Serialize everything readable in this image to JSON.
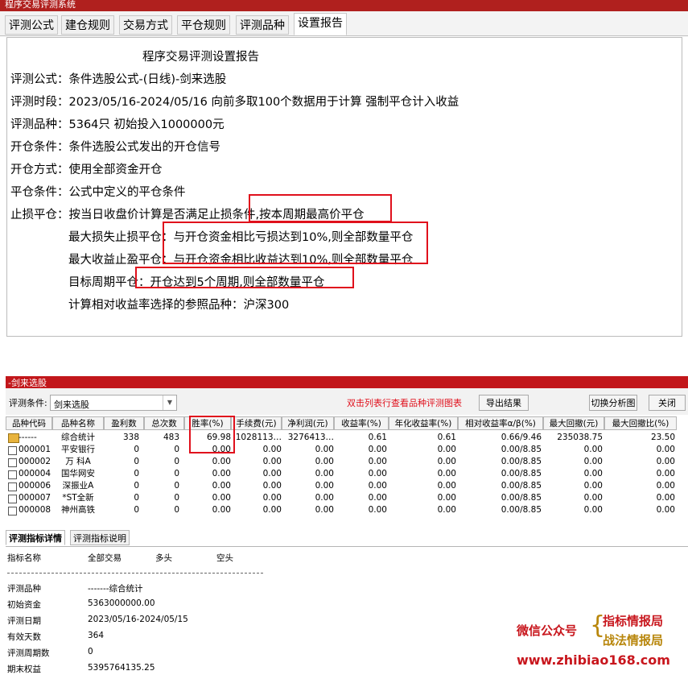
{
  "top_window": {
    "title": "程序交易评测系统",
    "tabs": [
      "评测公式",
      "建仓规则",
      "交易方式",
      "平仓规则",
      "评测品种",
      "设置报告"
    ],
    "active_tab": "设置报告",
    "report": {
      "heading": "程序交易评测设置报告",
      "formula": "评测公式：条件选股公式-(日线)-剑来选股",
      "period": "评测时段：2023/05/16-2024/05/16 向前多取100个数据用于计算 强制平仓计入收益",
      "symbols": "评测品种：5364只 初始投入1000000元",
      "open_cond": "开仓条件：条件选股公式发出的开仓信号",
      "open_mode": "开仓方式：使用全部资金开仓",
      "close_cond": "平仓条件：公式中定义的平仓条件",
      "stoploss": "止损平仓：按当日收盘价计算是否满足止损条件,按本周期最高价平仓",
      "max_loss": "最大损失止损平仓：与开仓资金相比亏损达到10%,则全部数量平仓",
      "max_gain": "最大收益止盈平仓：与开仓资金相比收益达到10%,则全部数量平仓",
      "target_period": "目标周期平仓：开仓达到5个周期,则全部数量平仓",
      "reference": "计算相对收益率选择的参照品种：沪深300"
    }
  },
  "bottom_window": {
    "title": "-剑来选股",
    "condition_label": "评测条件:",
    "condition_value": "剑来选股",
    "hint": "双击列表行查看品种评测图表",
    "export_button": "导出结果",
    "switch_button": "切换分析图",
    "close_button": "关闭",
    "columns": [
      "品种代码",
      "品种名称",
      "盈利数",
      "总次数",
      "胜率(%)",
      "手续费(元)",
      "净利润(元)",
      "收益率(%)",
      "年化收益率(%)",
      "相对收益率α/β(%)",
      "最大回撤(元)",
      "最大回撤比(%)"
    ],
    "rows": [
      [
        "------",
        "综合统计",
        "338",
        "483",
        "69.98",
        "1028113…",
        "3276413…",
        "0.61",
        "0.61",
        "0.66/9.46",
        "235038.75",
        "23.50"
      ],
      [
        "000001",
        "平安银行",
        "0",
        "0",
        "0.00",
        "0.00",
        "0.00",
        "0.00",
        "0.00",
        "0.00/8.85",
        "0.00",
        "0.00"
      ],
      [
        "000002",
        "万 科A",
        "0",
        "0",
        "0.00",
        "0.00",
        "0.00",
        "0.00",
        "0.00",
        "0.00/8.85",
        "0.00",
        "0.00"
      ],
      [
        "000004",
        "国华网安",
        "0",
        "0",
        "0.00",
        "0.00",
        "0.00",
        "0.00",
        "0.00",
        "0.00/8.85",
        "0.00",
        "0.00"
      ],
      [
        "000006",
        "深振业A",
        "0",
        "0",
        "0.00",
        "0.00",
        "0.00",
        "0.00",
        "0.00",
        "0.00/8.85",
        "0.00",
        "0.00"
      ],
      [
        "000007",
        "*ST全新",
        "0",
        "0",
        "0.00",
        "0.00",
        "0.00",
        "0.00",
        "0.00",
        "0.00/8.85",
        "0.00",
        "0.00"
      ],
      [
        "000008",
        "神州高铁",
        "0",
        "0",
        "0.00",
        "0.00",
        "0.00",
        "0.00",
        "0.00",
        "0.00/8.85",
        "0.00",
        "0.00"
      ]
    ],
    "detail_tabs": [
      "评测指标详情",
      "评测指标说明"
    ],
    "detail_header": [
      "指标名称",
      "全部交易",
      "多头",
      "空头"
    ],
    "indicators": [
      [
        "评测品种",
        "-------综合统计"
      ],
      [
        "初始资金",
        "5363000000.00"
      ],
      [
        "评测日期",
        "2023/05/16-2024/05/15"
      ],
      [
        "有效天数",
        "364"
      ],
      [
        "评测周期数",
        "0"
      ],
      [
        "期末权益",
        "5395764135.25"
      ]
    ]
  },
  "watermark": {
    "label": "微信公众号",
    "line1": "指标情报局",
    "line2": "战法情报局",
    "url": "www.zhibiao168.com"
  },
  "colors": {
    "titlebar": "#b0201e",
    "highlight_box": "#e0101c",
    "hint_text": "#e0101c",
    "watermark_red": "#c8161d",
    "watermark_gold": "#b8860b"
  }
}
